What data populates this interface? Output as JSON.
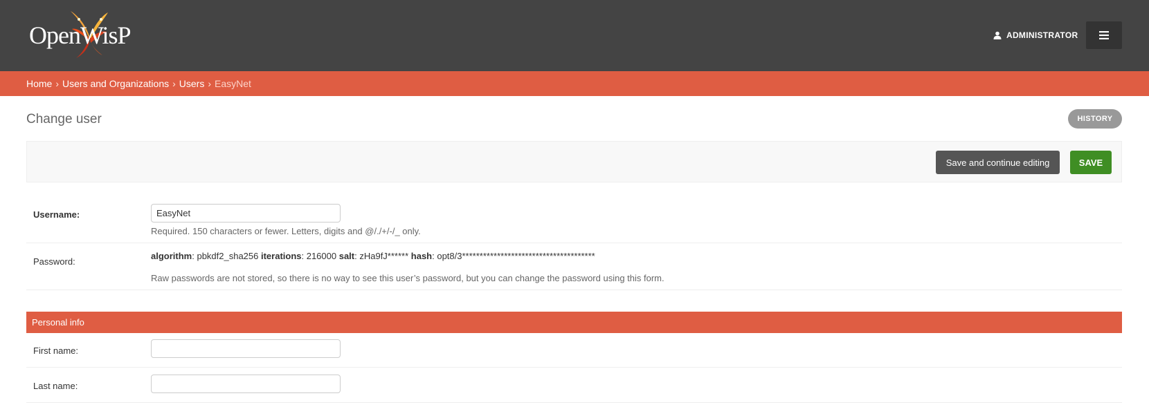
{
  "header": {
    "logo_text": "OpenWisP",
    "user_label": "ADMINISTRATOR"
  },
  "breadcrumbs": {
    "home": "Home",
    "section": "Users and Organizations",
    "model": "Users",
    "current": "EasyNet",
    "separator": "›"
  },
  "page": {
    "title": "Change user",
    "history_label": "HISTORY"
  },
  "submit_row": {
    "continue_label": "Save and continue editing",
    "save_label": "SAVE"
  },
  "form": {
    "username": {
      "label": "Username:",
      "value": "EasyNet",
      "help": "Required. 150 characters or fewer. Letters, digits and @/./+/-/_ only."
    },
    "password": {
      "label": "Password:",
      "algorithm_key": "algorithm",
      "algorithm_value": ": pbkdf2_sha256 ",
      "iterations_key": "iterations",
      "iterations_value": ": 216000 ",
      "salt_key": "salt",
      "salt_value": ": zHa9fJ****** ",
      "hash_key": "hash",
      "hash_value": ": opt8/3**************************************",
      "help": "Raw passwords are not stored, so there is no way to see this user’s password, but you can change the password using this form."
    },
    "personal_info": {
      "title": "Personal info",
      "first_name_label": "First name:",
      "first_name_value": "",
      "last_name_label": "Last name:",
      "last_name_value": ""
    }
  },
  "colors": {
    "header_bg": "#444444",
    "accent": "#df5d43",
    "save_green": "#3f8e24",
    "continue_gray": "#555555",
    "history_gray": "#999999"
  }
}
